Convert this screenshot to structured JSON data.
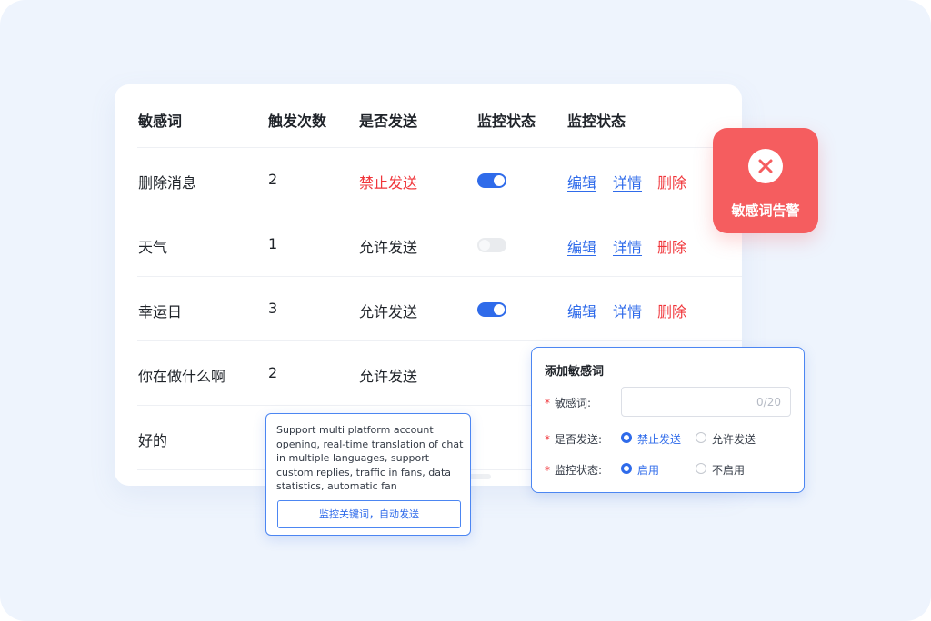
{
  "table": {
    "headers": [
      "敏感词",
      "触发次数",
      "是否发送",
      "监控状态",
      "监控状态"
    ],
    "rows": [
      {
        "word": "删除消息",
        "count": "2",
        "send": "禁止发送",
        "send_blocked": true,
        "monitor": "on",
        "actions": [
          "编辑",
          "详情",
          "删除"
        ]
      },
      {
        "word": "天气",
        "count": "1",
        "send": "允许发送",
        "send_blocked": false,
        "monitor": "off",
        "actions": [
          "编辑",
          "详情",
          "删除"
        ]
      },
      {
        "word": "幸运日",
        "count": "3",
        "send": "允许发送",
        "send_blocked": false,
        "monitor": "on",
        "actions": [
          "编辑",
          "详情",
          "删除"
        ]
      },
      {
        "word": "你在做什么啊",
        "count": "2",
        "send": "允许发送"
      },
      {
        "word": "好的"
      }
    ]
  },
  "alert": {
    "label": "敏感词告警",
    "icon": "close-icon",
    "color": "#f55d5f"
  },
  "tooltip": {
    "text": "Support multi platform account opening, real-time translation of chat in multiple languages, support custom replies, traffic in fans, data statistics, automatic fan",
    "button": "监控关键词，自动发送"
  },
  "form": {
    "title": "添加敏感词",
    "required_mark": "*",
    "word_label": "敏感词:",
    "word_value": "",
    "word_counter": "0/20",
    "send_label": "是否发送:",
    "send_options": [
      "禁止发送",
      "允许发送"
    ],
    "send_selected": "禁止发送",
    "monitor_label": "监控状态:",
    "monitor_options": [
      "启用",
      "不启用"
    ],
    "monitor_selected": "启用"
  },
  "colors": {
    "accent": "#2f6bea",
    "danger": "#f0353a",
    "background": "#eef4fd"
  }
}
